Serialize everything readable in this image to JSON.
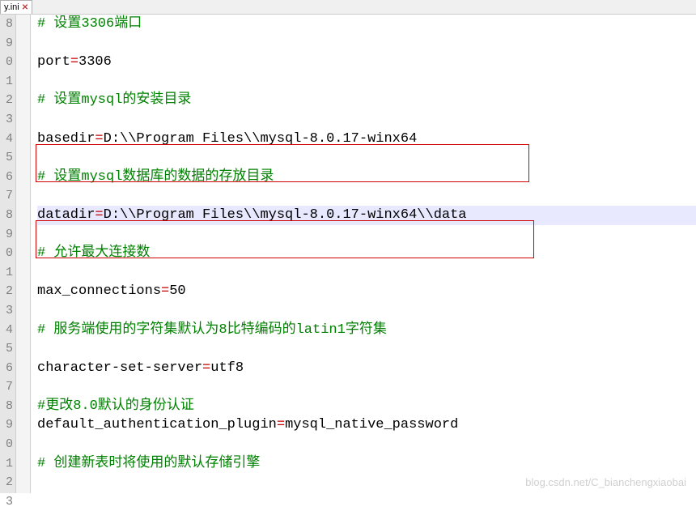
{
  "tab": {
    "filename": "y.ini",
    "close_glyph": "✕"
  },
  "gutter": [
    "8",
    "9",
    "0",
    "1",
    "2",
    "3",
    "4",
    "5",
    "6",
    "7",
    "8",
    "9",
    "0",
    "1",
    "2",
    "3",
    "4",
    "5",
    "6",
    "7",
    "8",
    "9",
    "0",
    "1",
    "2",
    "3"
  ],
  "lines": {
    "l8": {
      "hash": "# ",
      "comment": "设置3306端口"
    },
    "l9": {},
    "l10": {
      "key": "port",
      "eq": "=",
      "val": "3306"
    },
    "l11": {},
    "l12": {
      "hash": "# ",
      "comment": "设置mysql的安装目录"
    },
    "l13": {},
    "l14": {
      "key": "basedir",
      "eq": "=",
      "val": "D:\\\\Program Files\\\\mysql-8.0.17-winx64"
    },
    "l15": {},
    "l16": {
      "hash": "# ",
      "comment": "设置mysql数据库的数据的存放目录"
    },
    "l17": {},
    "l18": {
      "key": "datadir",
      "eq": "=",
      "val": "D:\\\\Program Files\\\\mysql-8.0.17-winx64\\\\data"
    },
    "l19": {},
    "l20": {
      "hash": "# ",
      "comment": "允许最大连接数"
    },
    "l21": {},
    "l22": {
      "key": "max_connections",
      "eq": "=",
      "val": "50"
    },
    "l23": {},
    "l24": {
      "hash": "# ",
      "comment": "服务端使用的字符集默认为8比特编码的latin1字符集"
    },
    "l25": {},
    "l26": {
      "key": "character-set-server",
      "eq": "=",
      "val": "utf8"
    },
    "l27": {},
    "l28": {
      "hash": "#",
      "comment": "更改8.0默认的身份认证"
    },
    "l29": {
      "key": "default_authentication_plugin",
      "eq": "=",
      "val": "mysql_native_password"
    },
    "l30": {},
    "l31": {
      "hash": "# ",
      "comment": "创建新表时将使用的默认存储引擎"
    },
    "l32": {}
  },
  "watermark": "blog.csdn.net/C_bianchengxiaobai"
}
